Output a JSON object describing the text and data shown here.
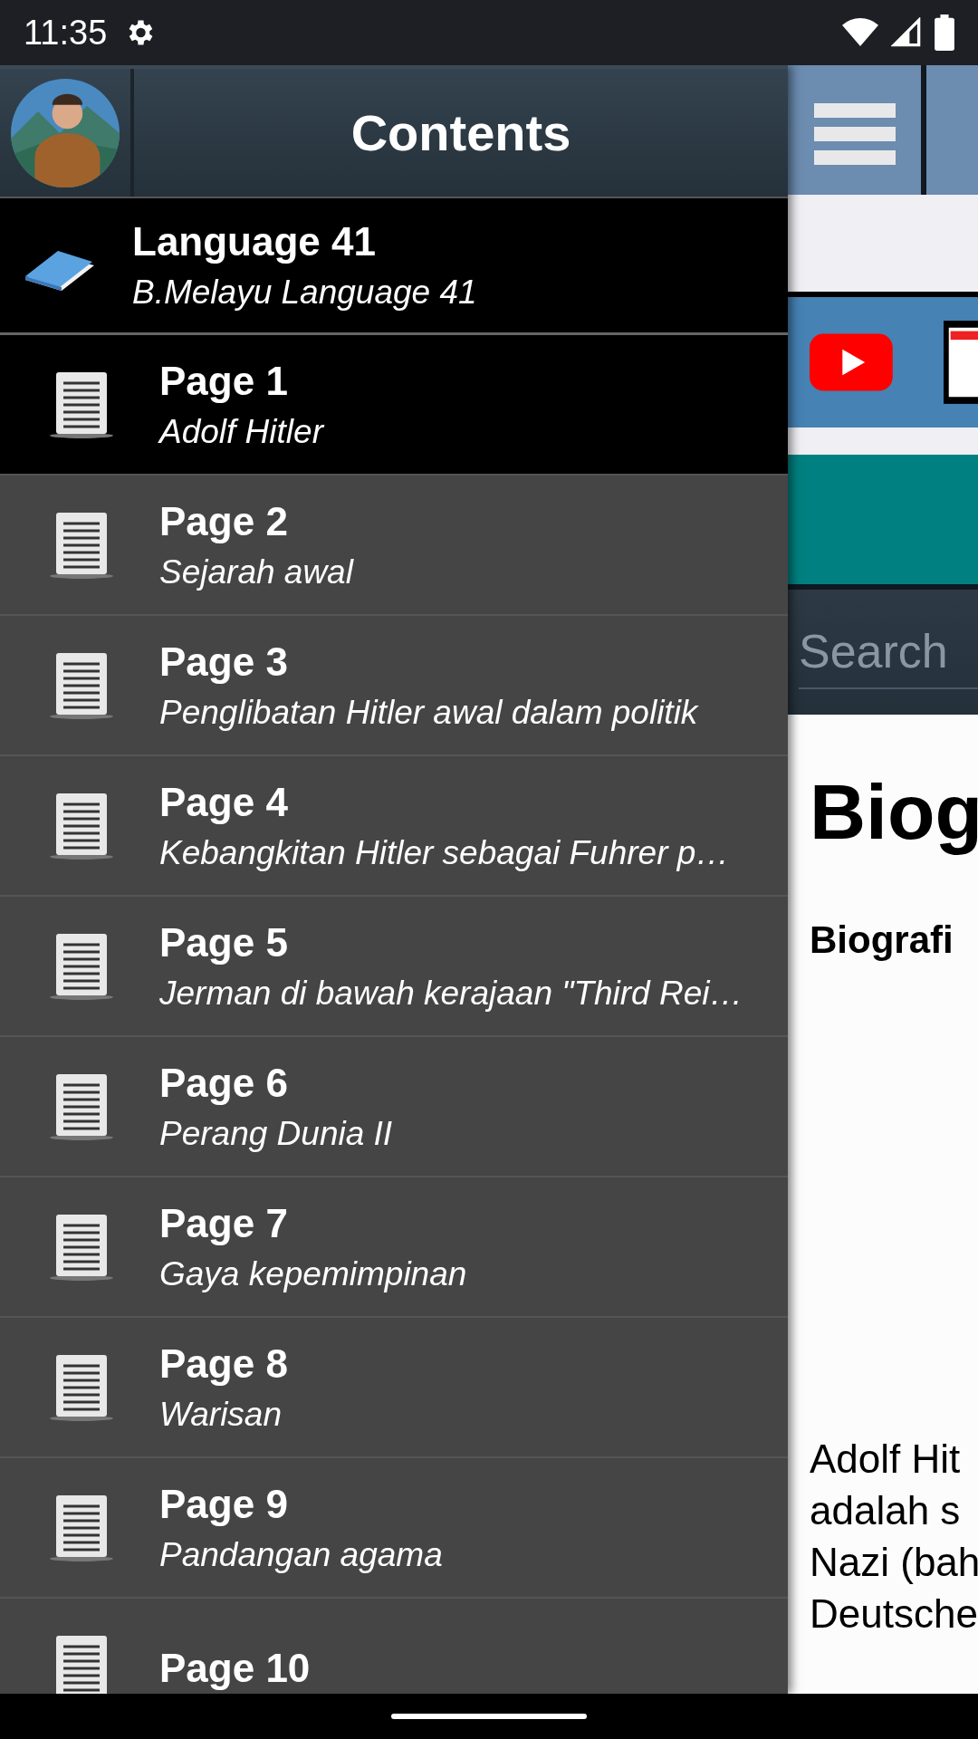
{
  "status_bar": {
    "time": "11:35"
  },
  "drawer": {
    "title": "Contents",
    "language": {
      "title": "Language 41",
      "subtitle": "B.Melayu Language 41"
    },
    "pages": [
      {
        "title": "Page 1",
        "subtitle": "Adolf Hitler",
        "selected": true
      },
      {
        "title": "Page 2",
        "subtitle": "Sejarah awal",
        "selected": false
      },
      {
        "title": "Page 3",
        "subtitle": "Penglibatan Hitler awal dalam politik",
        "selected": false
      },
      {
        "title": "Page 4",
        "subtitle": "Kebangkitan Hitler sebagai Fuhrer p…",
        "selected": false
      },
      {
        "title": "Page 5",
        "subtitle": "Jerman di bawah kerajaan \"Third Rei…",
        "selected": false
      },
      {
        "title": "Page 6",
        "subtitle": "Perang Dunia II",
        "selected": false
      },
      {
        "title": "Page 7",
        "subtitle": "Gaya kepemimpinan",
        "selected": false
      },
      {
        "title": "Page 8",
        "subtitle": "Warisan",
        "selected": false
      },
      {
        "title": "Page 9",
        "subtitle": "Pandangan agama",
        "selected": false
      },
      {
        "title": "Page 10",
        "selected": false
      }
    ]
  },
  "content": {
    "search": {
      "placeholder": "Search"
    },
    "heading": "Biog",
    "subheading": "Biografi",
    "paragraph_lines": [
      "Adolf Hit",
      "adalah s",
      "Nazi (bah",
      "Deutsche"
    ]
  }
}
